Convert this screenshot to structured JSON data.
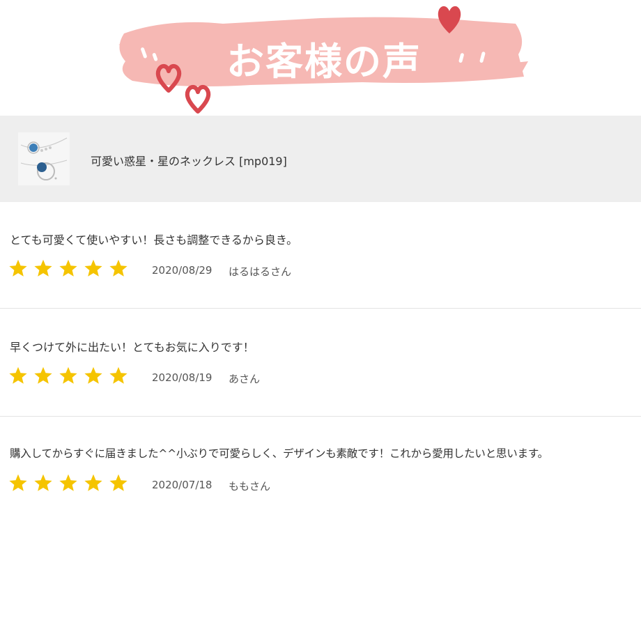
{
  "header": {
    "title": "お客様の声"
  },
  "product": {
    "name": "可愛い惑星・星のネックレス [mp019]"
  },
  "reviews": [
    {
      "text": "とても可愛くて使いやすい！長さも調整できるから良き。",
      "rating": 5,
      "date": "2020/08/29",
      "author": "はるはるさん"
    },
    {
      "text": "早くつけて外に出たい！とてもお気に入りです！",
      "rating": 5,
      "date": "2020/08/19",
      "author": "あさん"
    },
    {
      "text": "購入してからすぐに届きました^^小ぶりで可愛らしく、デザインも素敵です！これから愛用したいと思います。",
      "rating": 5,
      "date": "2020/07/18",
      "author": "ももさん"
    }
  ],
  "colors": {
    "brush": "#f6b8b4",
    "heart": "#d9484f",
    "star": "#f5c400",
    "product_bar": "#eeeeee"
  },
  "icons": {
    "rating": "star-icon",
    "decoration": "heart-icon"
  }
}
